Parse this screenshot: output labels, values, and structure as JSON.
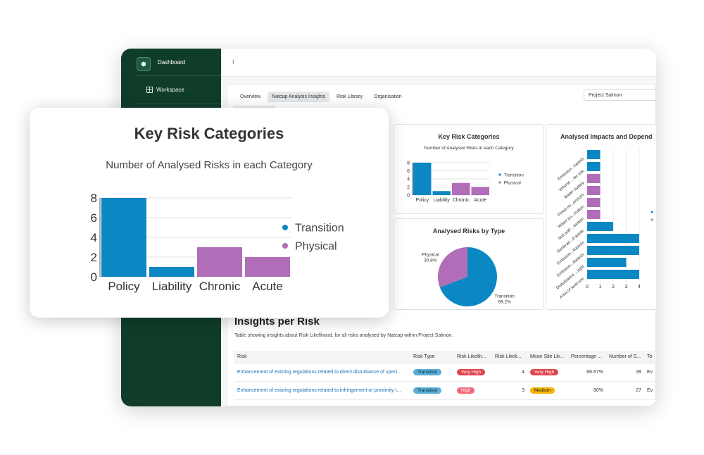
{
  "sidebar": {
    "dashboard_label": "Dashboard",
    "workspace_label": "Workspace"
  },
  "topbar": {
    "caret": "I"
  },
  "tabs": [
    "Overview",
    "Natcap Analysis Insights",
    "Risk Library",
    "Organisation"
  ],
  "project_select": {
    "value": "Project Salmon"
  },
  "key_risk_card": {
    "title": "Key Risk Categories",
    "subtitle": "Number of Analysed Risks in each Category"
  },
  "type_card": {
    "title": "Analysed Risks by Type"
  },
  "impacts_card": {
    "title": "Analysed Impacts and Depend"
  },
  "insights": {
    "title": "Insights per Risk",
    "subtitle": "Table showing insights about Risk Likelihood, for all risks analysed by Natcap within Project Salmon."
  },
  "table": {
    "headers": [
      "Risk",
      "Risk Type",
      "Risk Likelih...",
      "Risk Likeli...",
      "Mean Site Lik...",
      "Percentage ...",
      "Number of S...",
      "To"
    ],
    "rows": [
      {
        "risk": "Enhancement of existing regulations related to direct disturbance of speci...",
        "type": "Transition",
        "likelihood": "Very High",
        "score": "4",
        "mean": "Very High",
        "pct": "86.67%",
        "num": "39",
        "to": "Ev"
      },
      {
        "risk": "Enhancement of existing regulations related to infringement or proximity t...",
        "type": "Transition",
        "likelihood": "High",
        "score": "3",
        "mean": "Medium",
        "pct": "60%",
        "num": "27",
        "to": "Ev"
      }
    ]
  },
  "overlay": {
    "title": "Key Risk Categories",
    "subtitle": "Number of Analysed Risks in each Category"
  },
  "colors": {
    "transition": "#0b87c3",
    "physical": "#b06db8",
    "sidebar": "#0f3d2a"
  },
  "chart_data": [
    {
      "type": "bar",
      "title": "Key Risk Categories",
      "subtitle": "Number of Analysed Risks in each Category",
      "categories": [
        "Policy",
        "Liability",
        "Chronic",
        "Acute"
      ],
      "series": [
        {
          "name": "Transition",
          "values": [
            8,
            1,
            0,
            0
          ],
          "color": "#0b87c3"
        },
        {
          "name": "Physical",
          "values": [
            0,
            0,
            3,
            2
          ],
          "color": "#b06db8"
        }
      ],
      "yticks": [
        "0",
        "2",
        "4",
        "6",
        "8"
      ],
      "ylim": [
        0,
        8
      ],
      "grid": true,
      "legend": "right"
    },
    {
      "type": "pie",
      "title": "Analysed Risks by Type",
      "slices": [
        {
          "label": "Transition",
          "value": 69.2,
          "display": "69.2%",
          "color": "#0b87c3"
        },
        {
          "label": "Physical",
          "value": 30.8,
          "display": "30.8%",
          "color": "#b06db8"
        }
      ]
    },
    {
      "type": "bar",
      "orientation": "horizontal",
      "title": "Analysed Impacts and Depend",
      "categories": [
        "Emission...lutants",
        "Volume ...ter use",
        "Water supply",
        "Flood mi...ervices",
        "Water pu...ication",
        "Soil and ...tention",
        "Generati...d waste",
        "Emission...llutants",
        "Emission...llutants",
        "Disturbance ...light",
        "Area of land use"
      ],
      "values": [
        1,
        1,
        1,
        1,
        1,
        1,
        2,
        4,
        4,
        3,
        4
      ],
      "colors": [
        "#0b87c3",
        "#0b87c3",
        "#b06db8",
        "#b06db8",
        "#b06db8",
        "#b06db8",
        "#0b87c3",
        "#0b87c3",
        "#0b87c3",
        "#0b87c3",
        "#0b87c3"
      ],
      "xticks": [
        "0",
        "1",
        "2",
        "3",
        "4"
      ],
      "xlim": [
        0,
        4
      ]
    }
  ]
}
